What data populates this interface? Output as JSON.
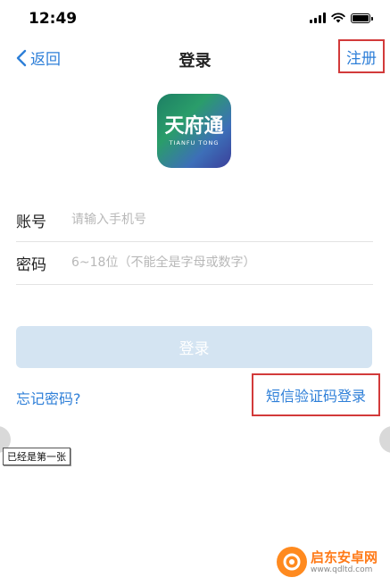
{
  "status": {
    "time": "12:49"
  },
  "nav": {
    "back_label": "返回",
    "title": "登录",
    "register_label": "注册"
  },
  "logo": {
    "main": "天府通",
    "sub": "TIANFU TONG"
  },
  "form": {
    "account_label": "账号",
    "account_placeholder": "请输入手机号",
    "password_label": "密码",
    "password_placeholder": "6~18位（不能全是字母或数字）"
  },
  "actions": {
    "login_label": "登录",
    "forgot_label": "忘记密码?",
    "sms_login_label": "短信验证码登录"
  },
  "tooltip": {
    "text": "已经是第一张"
  },
  "watermark": {
    "title": "启东安卓网",
    "url": "www.qdltd.com"
  },
  "colors": {
    "accent": "#2e7fd8",
    "highlight_box": "#d23a3a",
    "login_disabled": "#d4e4f2"
  }
}
